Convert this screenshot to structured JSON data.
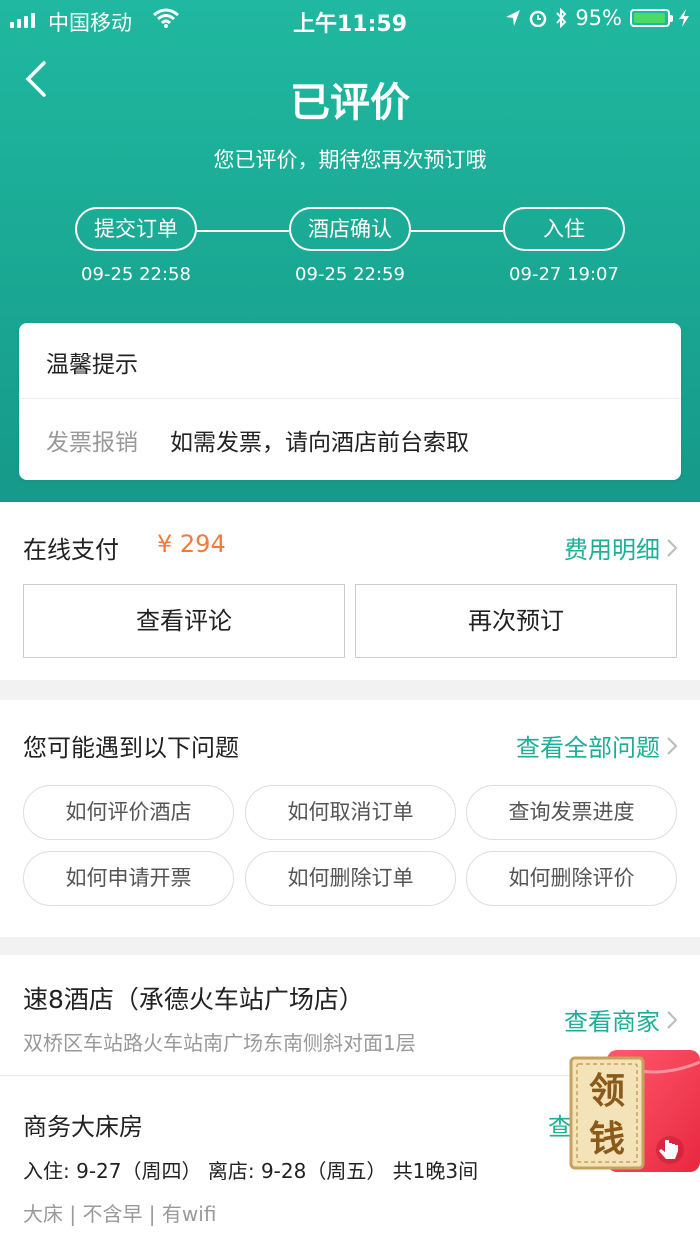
{
  "status_bar": {
    "carrier": "中国移动",
    "time": "上午11:59",
    "battery": "95%",
    "battery_level": 0.95,
    "battery_color": "#4cd964"
  },
  "header": {
    "title": "已评价",
    "subtitle": "您已评价，期待您再次预订哦",
    "back_icon": "chevron-left-icon",
    "bg_color": "#1aa893"
  },
  "progress": {
    "steps": [
      {
        "label": "提交订单",
        "time": "09-25 22:58"
      },
      {
        "label": "酒店确认",
        "time": "09-25 22:59"
      },
      {
        "label": "入住",
        "time": "09-27 19:07"
      }
    ]
  },
  "tip": {
    "title": "温馨提示",
    "label": "发票报销",
    "value": "如需发票，请向酒店前台索取"
  },
  "payment": {
    "label": "在线支付",
    "amount": "¥ 294",
    "fee_link": "费用明细",
    "buttons": [
      "查看评论",
      "再次预订"
    ],
    "amount_color": "#f27a3c",
    "accent_color": "#1dae98"
  },
  "faq": {
    "title": "您可能遇到以下问题",
    "link": "查看全部问题",
    "chips": [
      "如何评价酒店",
      "如何取消订单",
      "查询发票进度",
      "如何申请开票",
      "如何删除订单",
      "如何删除评价"
    ]
  },
  "hotel": {
    "name": "速8酒店（承德火车站广场店）",
    "address": "双桥区车站路火车站南广场东南侧斜对面1层",
    "merchant_link": "查看商家",
    "room_name": "商务大床房",
    "room_link": "查",
    "dates": "入住: 9-27（周四） 离店: 9-28（周五） 共1晚3间",
    "features": "大床 | 不含早 | 有wifi"
  },
  "floating": {
    "label_top": "领",
    "label_bottom": "钱",
    "icon": "red-envelope-icon"
  }
}
